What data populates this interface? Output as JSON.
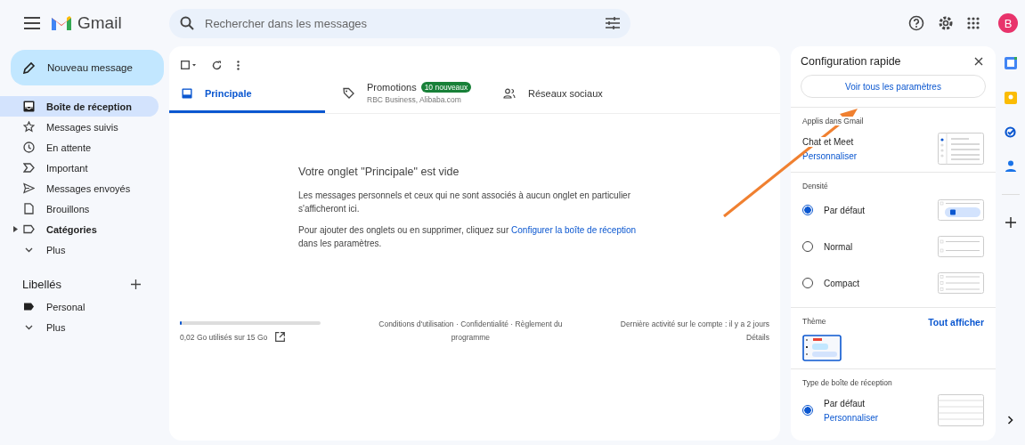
{
  "header": {
    "app_name": "Gmail",
    "search": {
      "placeholder": "Rechercher dans les messages"
    },
    "avatar": "B"
  },
  "sidebar": {
    "compose": "Nouveau message",
    "items": [
      {
        "label": "Boîte de réception",
        "selected": true,
        "bold": true
      },
      {
        "label": "Messages suivis",
        "selected": false,
        "bold": false
      },
      {
        "label": "En attente",
        "selected": false,
        "bold": false
      },
      {
        "label": "Important",
        "selected": false,
        "bold": false
      },
      {
        "label": "Messages envoyés",
        "selected": false,
        "bold": false
      },
      {
        "label": "Brouillons",
        "selected": false,
        "bold": false
      },
      {
        "label": "Catégories",
        "selected": false,
        "bold": true,
        "expanded": false
      },
      {
        "label": "Plus",
        "selected": false,
        "bold": false
      }
    ],
    "labels_title": "Libellés",
    "labels": [
      {
        "label": "Personal"
      },
      {
        "label": "Plus"
      }
    ]
  },
  "tabs": [
    {
      "label": "Principale",
      "selected": true
    },
    {
      "label": "Promotions",
      "selected": false,
      "badge": "10 nouveaux",
      "subtitle": "RBC Business, Alibaba.com"
    },
    {
      "label": "Réseaux sociaux",
      "selected": false
    }
  ],
  "empty_state": {
    "title": "Votre onglet \"Principale\" est vide",
    "message": "Les messages personnels et ceux qui ne sont associés à aucun onglet en particulier s'afficheront ici.",
    "hint": "Pour ajouter des onglets ou en supprimer, cliquez sur",
    "hint_link": "Configurer la boîte de réception",
    "hint_end": "dans les paramètres."
  },
  "footer": {
    "storage": {
      "level": 0.01,
      "text": "0,02 Go utilisés sur 15 Go"
    },
    "terms": "Conditions d'utilisation · Confidentialité · Règlement du programme",
    "activity": "Dernière activité sur le compte : il y a 2 jours",
    "details": "Détails"
  },
  "quick_settings": {
    "title": "Configuration rapide",
    "all_settings": "Voir tous les paramètres",
    "apps": {
      "title": "Applis dans Gmail",
      "label": "Chat et Meet",
      "link": "Personnaliser"
    },
    "density": {
      "title": "Densité",
      "options": [
        {
          "label": "Par défaut",
          "selected": true
        },
        {
          "label": "Normal",
          "selected": false
        },
        {
          "label": "Compact",
          "selected": false
        }
      ]
    },
    "theme": {
      "title": "Thème",
      "link": "Tout afficher"
    },
    "inbox_type": {
      "title": "Type de boîte de réception",
      "options": [
        {
          "label": "Par défaut",
          "selected": true,
          "link": "Personnaliser"
        }
      ]
    }
  }
}
